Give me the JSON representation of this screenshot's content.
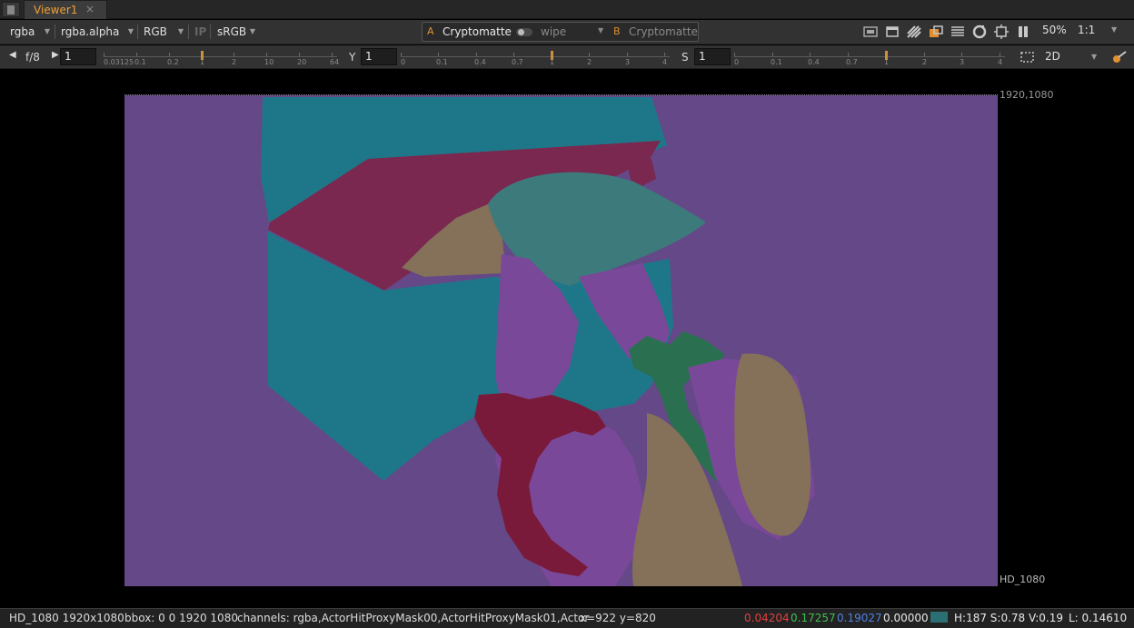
{
  "tab": {
    "title": "Viewer1",
    "close": "×"
  },
  "toolbar1": {
    "channels": "rgba",
    "alpha_channel": "rgba.alpha",
    "display_channels": "RGB",
    "ip": "IP",
    "lut": "sRGB",
    "input_a_letter": "A",
    "input_a": "Cryptomatte",
    "wipe_mode": "wipe",
    "input_b_letter": "B",
    "input_b": "Cryptomatte",
    "zoom": "50%",
    "proxy": "1:1"
  },
  "toolbar2": {
    "fstop": "f/8",
    "gain_value": "1",
    "gain_ticks": [
      "0.03125",
      "0.1",
      "0.2",
      "1",
      "2",
      "10",
      "20",
      "64"
    ],
    "gamma_label": "Y",
    "gamma_value": "1",
    "gamma_ticks": [
      "0",
      "0.1",
      "0.4",
      "0.7",
      "1",
      "2",
      "3",
      "4"
    ],
    "saturation_label": "S",
    "saturation_value": "1",
    "saturation_ticks": [
      "0",
      "0.1",
      "0.4",
      "0.7",
      "1",
      "2",
      "3",
      "4"
    ],
    "view_mode": "2D"
  },
  "viewer": {
    "format_top_right": "1920,1080",
    "format_bottom_right": "HD_1080"
  },
  "status": {
    "format": "HD_1080 1920x1080",
    "bbox": "bbox: 0 0 1920 1080",
    "channels": "channels: rgba,ActorHitProxyMask00,ActorHitProxyMask01,Actor",
    "coords": "x=922 y=820",
    "r": "0.04204",
    "g": "0.17257",
    "b": "0.19027",
    "a": "0.00000",
    "hsv": "H:187 S:0.78 V:0.19",
    "luma": "L: 0.14610"
  },
  "colors": {
    "accent": "#f0a030",
    "background_matte": "#654888",
    "box_matte": "#1e7788",
    "red_matte": "#7a2850",
    "teal_leaf": "#3d7a7c",
    "green_matte": "#2a7050",
    "dark_red_matte": "#7a1a3a",
    "tan_matte": "#85705a"
  }
}
